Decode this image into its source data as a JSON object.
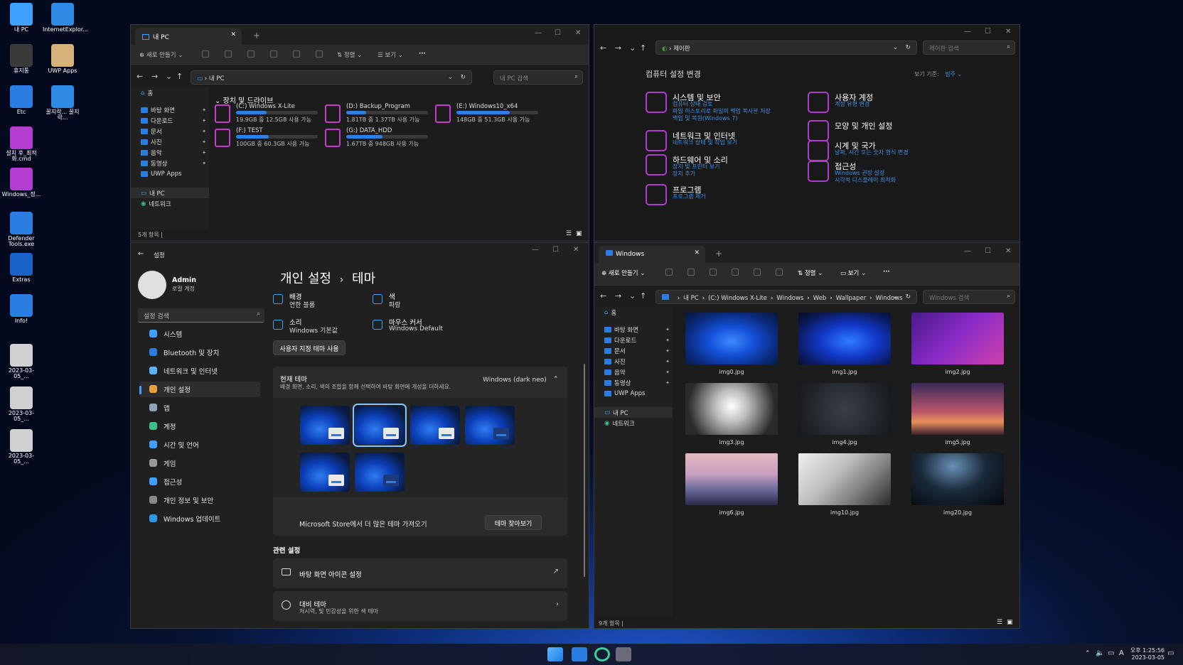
{
  "desktop": {
    "icons": [
      {
        "label": "내 PC",
        "color": "#3fa1ff"
      },
      {
        "label": "InternetExplor...",
        "color": "#2f8ae6"
      },
      {
        "label": "휴지통",
        "color": "#3a3a3a"
      },
      {
        "label": "UWP Apps",
        "color": "#d6b27a"
      },
      {
        "label": "Etc",
        "color": "#2a7de1"
      },
      {
        "label": "꿀지락... 꿀지락...",
        "color": "#2f8ae6"
      },
      {
        "label": "설치 후_최적화.cmd",
        "color": "#b33dd0"
      },
      {
        "label": "Windows_정...",
        "color": "#b33dd0"
      },
      {
        "label": "Defender Tools.exe",
        "color": "#2a7de1"
      },
      {
        "label": "Extras",
        "color": "#1a62c8"
      },
      {
        "label": "Info!",
        "color": "#2a7de1"
      },
      {
        "label": "2023-03-05_...",
        "color": "#d0d0d0"
      },
      {
        "label": "2023-03-05_...",
        "color": "#d0d0d0"
      },
      {
        "label": "2023-03-05_...",
        "color": "#d0d0d0"
      }
    ]
  },
  "explorer1": {
    "tab": "내 PC",
    "toolbar": {
      "new": "새로 만들기",
      "sort": "정렬",
      "view": "보기",
      "more": "···"
    },
    "address": "내 PC",
    "search_placeholder": "내 PC 검색",
    "nav": {
      "home": "홈",
      "quick": [
        "바탕 화면",
        "다운로드",
        "문서",
        "사진",
        "음악",
        "동영상",
        "UWP Apps"
      ],
      "pc": "내 PC",
      "network": "네트워크"
    },
    "group": "장치 및 드라이브",
    "drives": [
      {
        "name": "(C:) Windows X-Lite",
        "size": "19.9GB 중 12.5GB 사용 가능",
        "used": 0.37
      },
      {
        "name": "(D:) Backup_Program",
        "size": "1.81TB 중 1.37TB 사용 가능",
        "used": 0.24
      },
      {
        "name": "(E:) Windows10_x64",
        "size": "148GB 중 51.3GB 사용 가능",
        "used": 0.65
      },
      {
        "name": "(F:) TEST",
        "size": "100GB 중 60.3GB 사용 가능",
        "used": 0.4
      },
      {
        "name": "(G:) DATA_HDD",
        "size": "1.67TB 중 948GB 사용 가능",
        "used": 0.44
      }
    ],
    "status": "5개 항목  |"
  },
  "control_panel": {
    "address": "제어판",
    "search_placeholder": "제어판 검색",
    "title": "컴퓨터 설정 변경",
    "view_by_label": "보기 기준:",
    "view_by_value": "범주 ⌄",
    "items_left": [
      {
        "title": "시스템 및 보안",
        "sub": [
          "컴퓨터 상태 검토",
          "파일 히스토리로 파일의 백업 복사본 저장",
          "백업 및 복원(Windows 7)"
        ]
      },
      {
        "title": "네트워크 및 인터넷",
        "sub": [
          "네트워크 상태 및 작업 보기"
        ]
      },
      {
        "title": "하드웨어 및 소리",
        "sub": [
          "장치 및 프린터 보기",
          "장치 추가"
        ]
      },
      {
        "title": "프로그램",
        "sub": [
          "프로그램 제거"
        ]
      }
    ],
    "items_right": [
      {
        "title": "사용자 계정",
        "sub": [
          "계정 유형 변경"
        ]
      },
      {
        "title": "모양 및 개인 설정",
        "sub": []
      },
      {
        "title": "시계 및 국가",
        "sub": [
          "날짜, 시간 또는 숫자 형식 변경"
        ]
      },
      {
        "title": "접근성",
        "sub": [
          "Windows 권장 설정",
          "시각적 디스플레이 최적화"
        ]
      }
    ]
  },
  "settings": {
    "title": "설정",
    "user": {
      "name": "Admin",
      "type": "로컬 계정"
    },
    "search_placeholder": "설정 검색",
    "nav": [
      {
        "label": "시스템",
        "color": "#3fa1ff"
      },
      {
        "label": "Bluetooth 및 장치",
        "color": "#2a7de1"
      },
      {
        "label": "네트워크 및 인터넷",
        "color": "#5db2ff"
      },
      {
        "label": "개인 설정",
        "color": "#e8a040"
      },
      {
        "label": "앱",
        "color": "#8fa3b8"
      },
      {
        "label": "계정",
        "color": "#3cc08c"
      },
      {
        "label": "시간 및 언어",
        "color": "#3fa1ff"
      },
      {
        "label": "게임",
        "color": "#9a9a9a"
      },
      {
        "label": "접근성",
        "color": "#3fa1ff"
      },
      {
        "label": "개인 정보 및 보안",
        "color": "#8a8a8a"
      },
      {
        "label": "Windows 업데이트",
        "color": "#2a9ae6"
      }
    ],
    "selected_index": 3,
    "breadcrumb_parent": "개인 설정",
    "breadcrumb_sep": "›",
    "breadcrumb_current": "테마",
    "props": [
      {
        "label": "배경",
        "value": "연한 블룸"
      },
      {
        "label": "색",
        "value": "파랑"
      },
      {
        "label": "소리",
        "value": "Windows 기본값"
      },
      {
        "label": "마우스 커서",
        "value": "Windows Default"
      }
    ],
    "custom_theme_button": "사용자 지정 테마 사용",
    "current_theme": {
      "title": "현재 테마",
      "desc": "배경 화면, 소리, 색의 조합을 함께 선택하여 바탕 화면에 개성을 더하세요.",
      "value": "Windows (dark neo)"
    },
    "store_text": "Microsoft Store에서 더 많은 테마 가져오기",
    "browse_button": "테마 찾아보기",
    "related_label": "관련 설정",
    "related": [
      {
        "title": "바탕 화면 아이콘 설정",
        "sub": ""
      },
      {
        "title": "대비 테마",
        "sub": "저시력, 빛 민감성을 위한 색 테마"
      }
    ]
  },
  "explorer2": {
    "tab": "Windows",
    "toolbar": {
      "new": "새로 만들기",
      "sort": "정렬",
      "view": "보기",
      "more": "···"
    },
    "crumbs": [
      "내 PC",
      "(C:) Windows X-Lite",
      "Windows",
      "Web",
      "Wallpaper",
      "Windows"
    ],
    "crumb_sep": "›",
    "search_placeholder": "Windows 검색",
    "nav": {
      "home": "홈",
      "quick": [
        "바탕 화면",
        "다운로드",
        "문서",
        "사진",
        "음악",
        "동영상",
        "UWP Apps"
      ],
      "pc": "내 PC",
      "network": "네트워크"
    },
    "images": [
      {
        "name": "img0.jpg",
        "bg": "radial-gradient(ellipse at 50% 55%,#3d8bff 0%,#1450d8 35%,#0a2a7a 70%,#07163a 100%)"
      },
      {
        "name": "img1.jpg",
        "bg": "radial-gradient(ellipse at 55% 55%,#2f7cff 0%,#1238c8 40%,#0a1a5a 75%,#050c24 100%)"
      },
      {
        "name": "img2.jpg",
        "bg": "linear-gradient(135deg,#4a1a8a 0%,#8a2bc8 50%,#d040a8 100%)"
      },
      {
        "name": "img3.jpg",
        "bg": "radial-gradient(circle at 50% 45%,#ffffff 0%,#bdbdbd 30%,#2a2a2a 80%)"
      },
      {
        "name": "img4.jpg",
        "bg": "radial-gradient(circle at 50% 50%,#3a3f48 0%,#24282e 60%,#15181c 100%)"
      },
      {
        "name": "img5.jpg",
        "bg": "linear-gradient(180deg,#3a2a5a 0%,#b8566a 55%,#e8905a 75%,#3a2030 100%)"
      },
      {
        "name": "img6.jpg",
        "bg": "linear-gradient(180deg,#e6b8c0 0%,#c8a0c0 40%,#6a6a9a 70%,#2a2a4a 100%)"
      },
      {
        "name": "img10.jpg",
        "bg": "linear-gradient(135deg,#f0f0f0 0%,#bfbfbf 40%,#7a7a7a 70%,#2a2a2a 100%)"
      },
      {
        "name": "img20.jpg",
        "bg": "radial-gradient(ellipse at 45% 25%,#6a90b8 0%,#1a2a3a 45%,#05080c 100%)"
      }
    ],
    "status": "9개 항목  |"
  },
  "taskbar": {
    "time": "오후 1:25:56",
    "date": "2023-03-05",
    "lang": "A"
  }
}
